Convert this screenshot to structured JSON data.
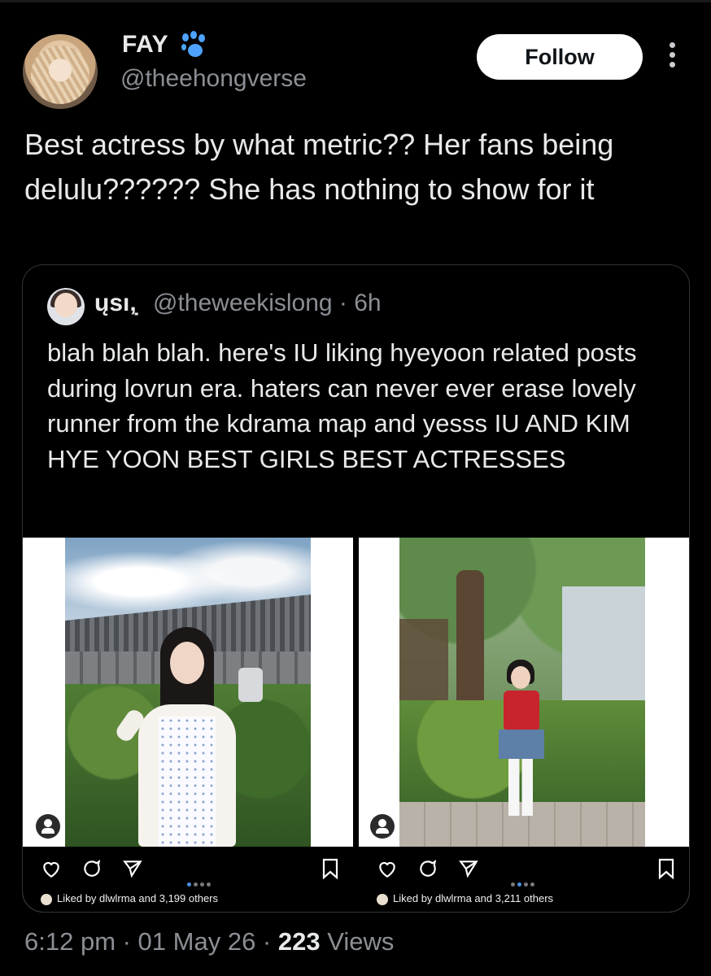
{
  "author": {
    "name": "FAY",
    "emoji": "🐾",
    "handle": "@theehongverse",
    "follow_label": "Follow"
  },
  "tweet": {
    "text": "Best actress by what metric?? Her fans being delulu?????? She has nothing to show for it"
  },
  "quote": {
    "name": "ųsı,̣",
    "handle_time": "@theweekislong · 6h",
    "text": "blah blah blah. here's IU liking hyeyoon related posts during lovrun era. haters can never ever erase lovely runner from the kdrama map and yesss IU AND KIM HYE YOON BEST GIRLS BEST ACTRESSES"
  },
  "instagram_posts": [
    {
      "liked_by": "Liked by dlwlrma and 3,199 others"
    },
    {
      "liked_by": "Liked by dlwlrma and 3,211 others"
    }
  ],
  "footer": {
    "time_date": "6:12 pm · 01 May 26 · ",
    "views_count": "223",
    "views_label": " Views"
  },
  "icons": [
    "more-options-icon",
    "paw-icon",
    "heart-icon",
    "comment-icon",
    "share-icon",
    "bookmark-icon",
    "user-tag-icon"
  ]
}
